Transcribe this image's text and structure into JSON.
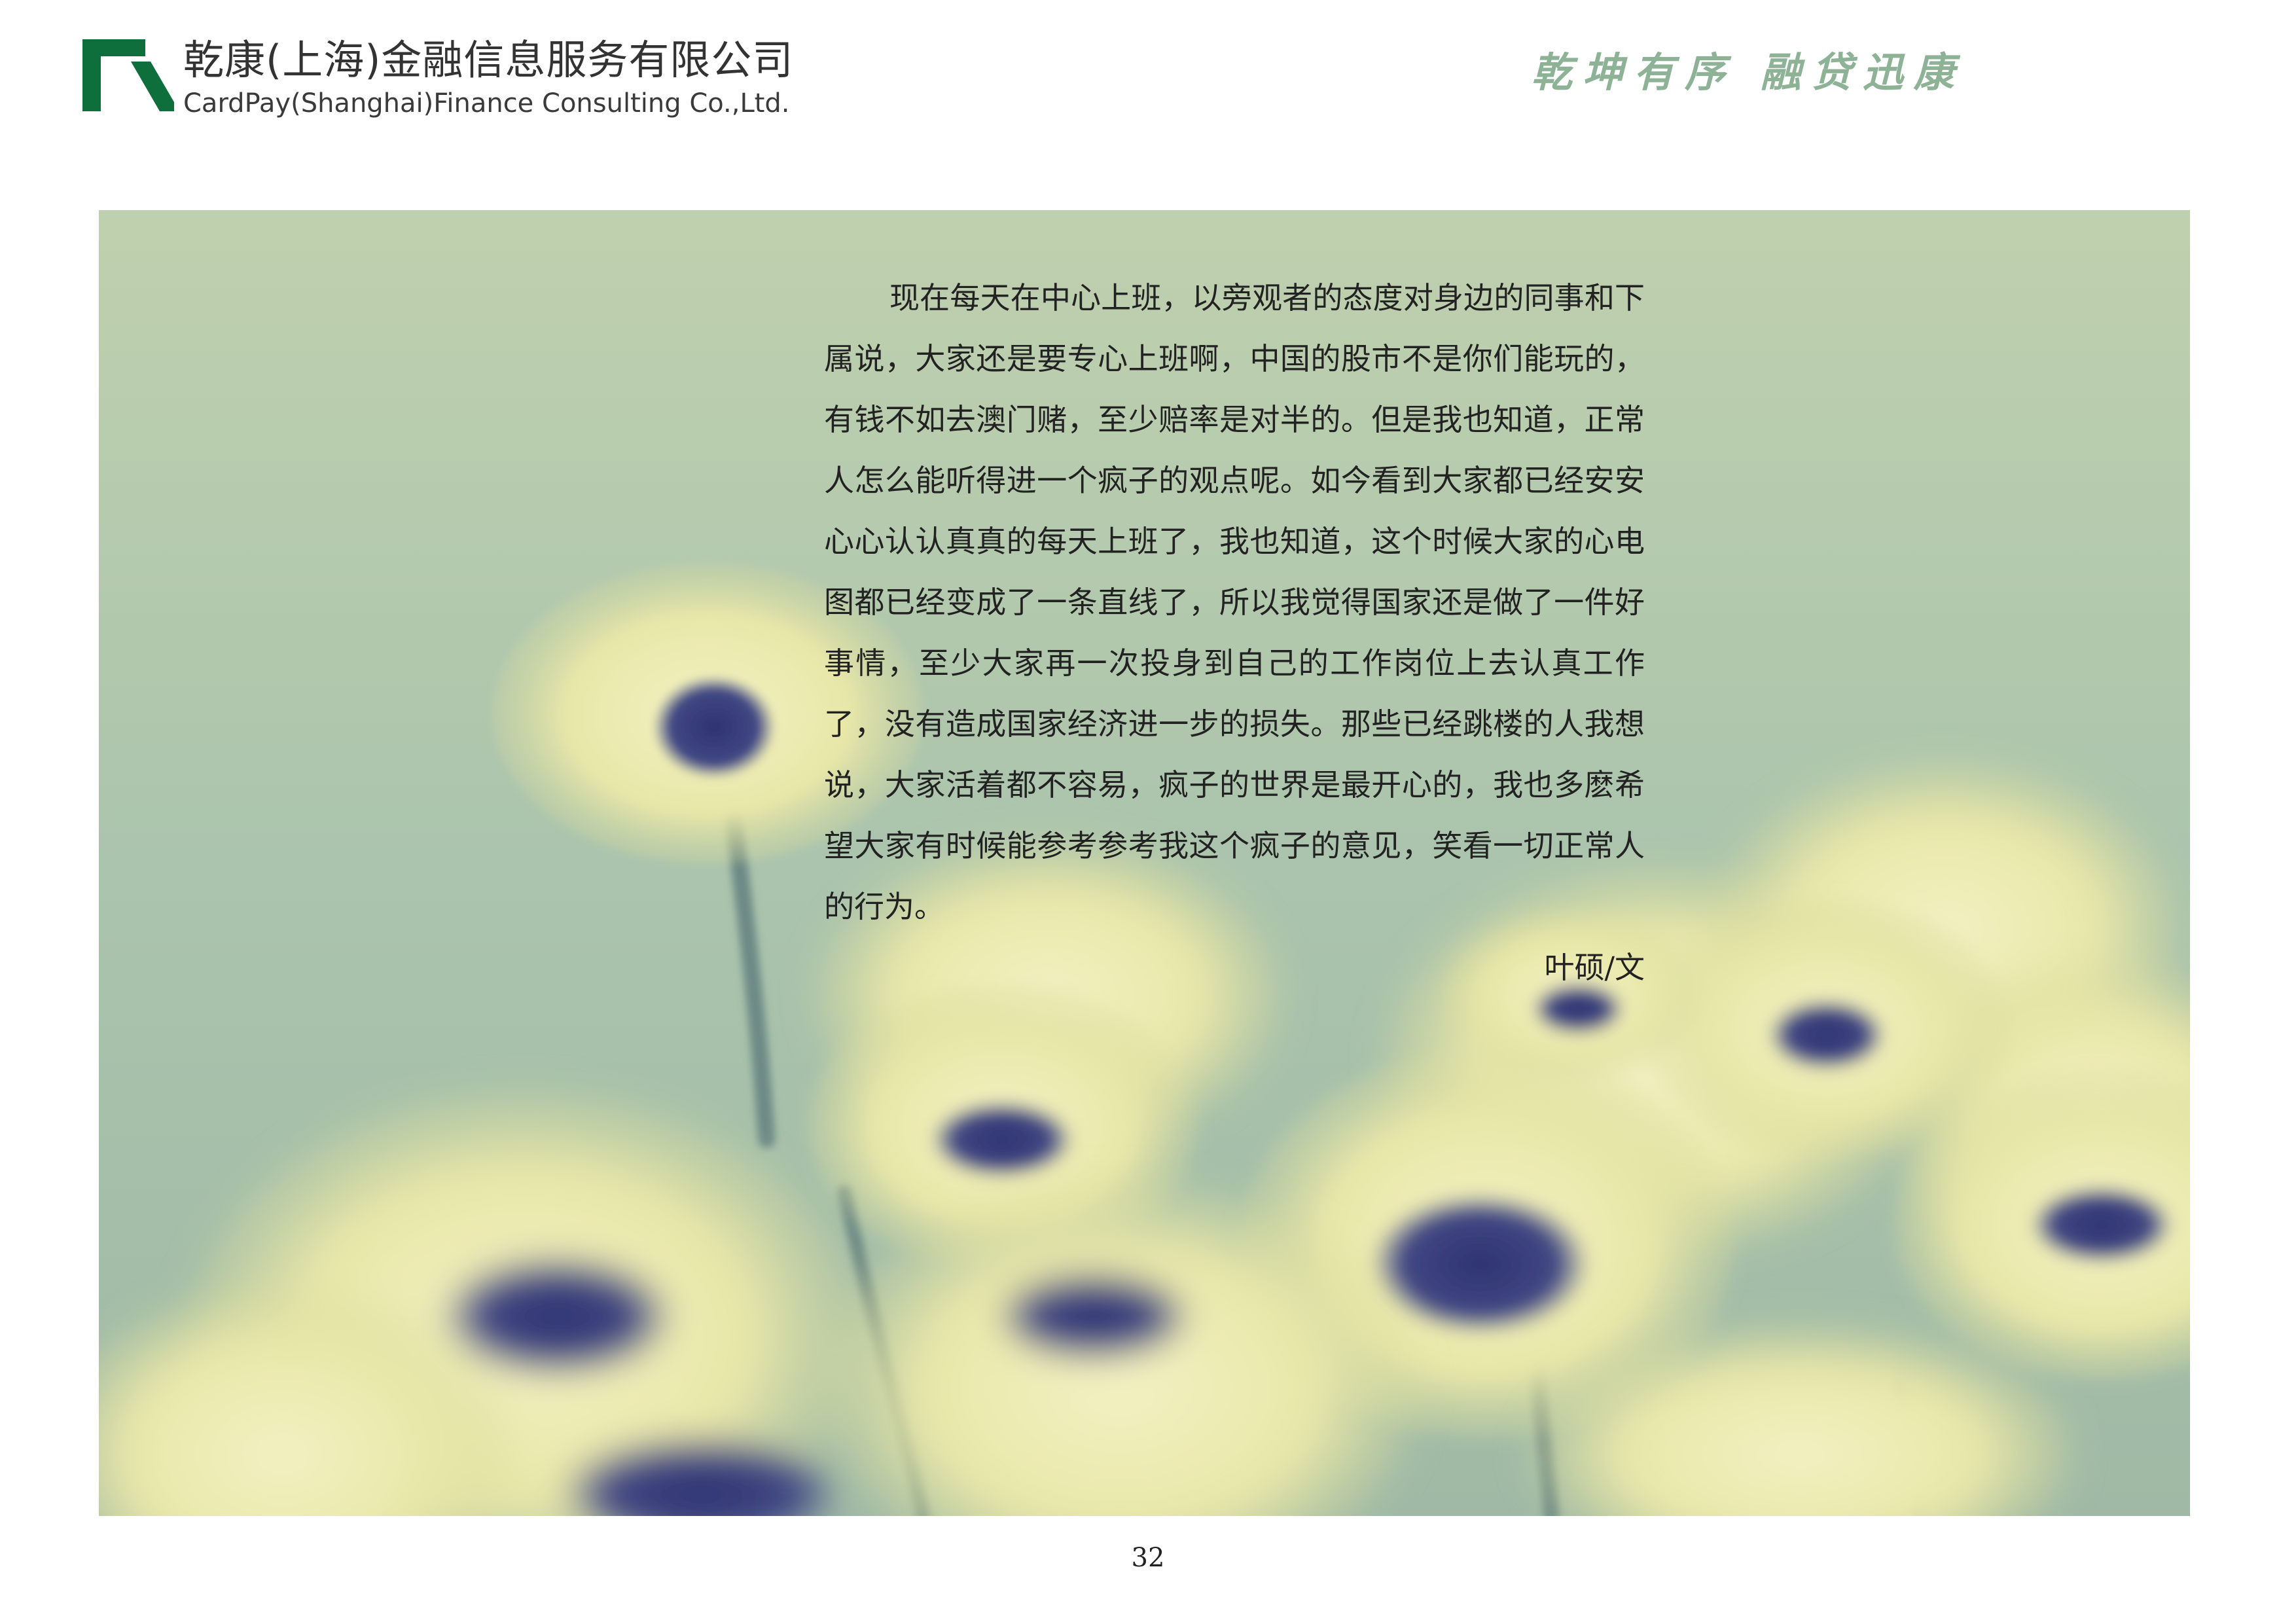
{
  "header": {
    "company_name_cn": "乾康(上海)金融信息服务有限公司",
    "company_name_en": "CardPay(Shanghai)Finance Consulting Co.,Ltd.",
    "slogan": "乾坤有序 融贷迅康"
  },
  "article": {
    "body": "现在每天在中心上班，以旁观者的态度对身边的同事和下属说，大家还是要专心上班啊，中国的股市不是你们能玩的，有钱不如去澳门赌，至少赔率是对半的。但是我也知道，正常人怎么能听得进一个疯子的观点呢。如今看到大家都已经安安心心认认真真的每天上班了，我也知道，这个时候大家的心电图都已经变成了一条直线了，所以我觉得国家还是做了一件好事情，至少大家再一次投身到自己的工作岗位上去认真工作了，没有造成国家经济进一步的损失。那些已经跳楼的人我想说，大家活着都不容易，疯子的世界是最开心的，我也多麽希望大家有时候能参考参考我这个疯子的意见，笑看一切正常人的行为。",
    "author": "叶硕/文"
  },
  "page_number": "32",
  "colors": {
    "logo_green": "#0e6e3c",
    "slogan_green": "#8db296",
    "photo_sky": "#b4c8ad",
    "flower_yellow": "#ecebb0",
    "flower_center": "#3a3f78"
  }
}
